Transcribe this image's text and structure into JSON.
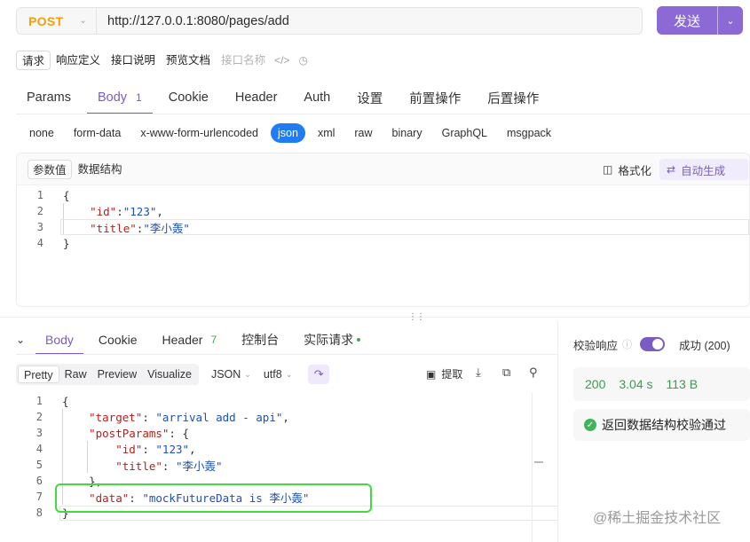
{
  "request": {
    "method": "POST",
    "url": "http://127.0.0.1:8080/pages/add",
    "send_label": "发送"
  },
  "doc_tabs": [
    "请求",
    "响应定义",
    "接口说明",
    "预览文档",
    "接口名称"
  ],
  "request_tabs": {
    "params": "Params",
    "body": "Body",
    "body_count": "1",
    "cookie": "Cookie",
    "header": "Header",
    "auth": "Auth",
    "settings": "设置",
    "pre_ops": "前置操作",
    "post_ops": "后置操作"
  },
  "body_types": [
    "none",
    "form-data",
    "x-www-form-urlencoded",
    "json",
    "xml",
    "raw",
    "binary",
    "GraphQL",
    "msgpack"
  ],
  "request_editor": {
    "seg_values": "参数值",
    "seg_structure": "数据结构",
    "format_label": "格式化",
    "autogen_label": "自动生成",
    "line_numbers": [
      "1",
      "2",
      "3",
      "4"
    ],
    "lines": {
      "l1": "{",
      "l2_key": "\"id\"",
      "l2_sep": ":",
      "l2_val": "\"123\"",
      "l2_end": ",",
      "l3_key": "\"title\"",
      "l3_sep": ":",
      "l3_val": "\"李小轰\"",
      "l4": "}"
    }
  },
  "response_tabs": {
    "body": "Body",
    "cookie": "Cookie",
    "header": "Header",
    "header_count": "7",
    "console": "控制台",
    "actual_request": "实际请求"
  },
  "response_toolbar": {
    "view_modes": [
      "Pretty",
      "Raw",
      "Preview",
      "Visualize"
    ],
    "format": "JSON",
    "encoding": "utf8",
    "extract_label": "提取"
  },
  "response_code": {
    "line_numbers": [
      "1",
      "2",
      "3",
      "4",
      "5",
      "6",
      "7",
      "8"
    ],
    "l1": "{",
    "target_key": "\"target\"",
    "target_val": "\"arrival add - api\"",
    "post_key": "\"postParams\"",
    "post_open": ": {",
    "id_key": "\"id\"",
    "id_val": "\"123\"",
    "title_key": "\"title\"",
    "title_val": "\"李小轰\"",
    "post_close": "},",
    "data_key": "\"data\"",
    "data_val": "\"mockFutureData is 李小轰\"",
    "l8": "}",
    "colon": ": ",
    "comma": ","
  },
  "validation": {
    "label": "校验响应",
    "status_text": "成功 (200)",
    "enabled": true,
    "status_code": "200",
    "time": "3.04 s",
    "size": "113 B",
    "success_message": "返回数据结构校验通过"
  },
  "watermark": "@稀土掘金技术社区",
  "colors": {
    "accent": "#7b5cc4",
    "send_button": "#8b6ad6",
    "method": "#f59e0b",
    "json_pill": "#1f7cf2",
    "success": "#3fa55a",
    "highlight_box": "#43d943"
  }
}
